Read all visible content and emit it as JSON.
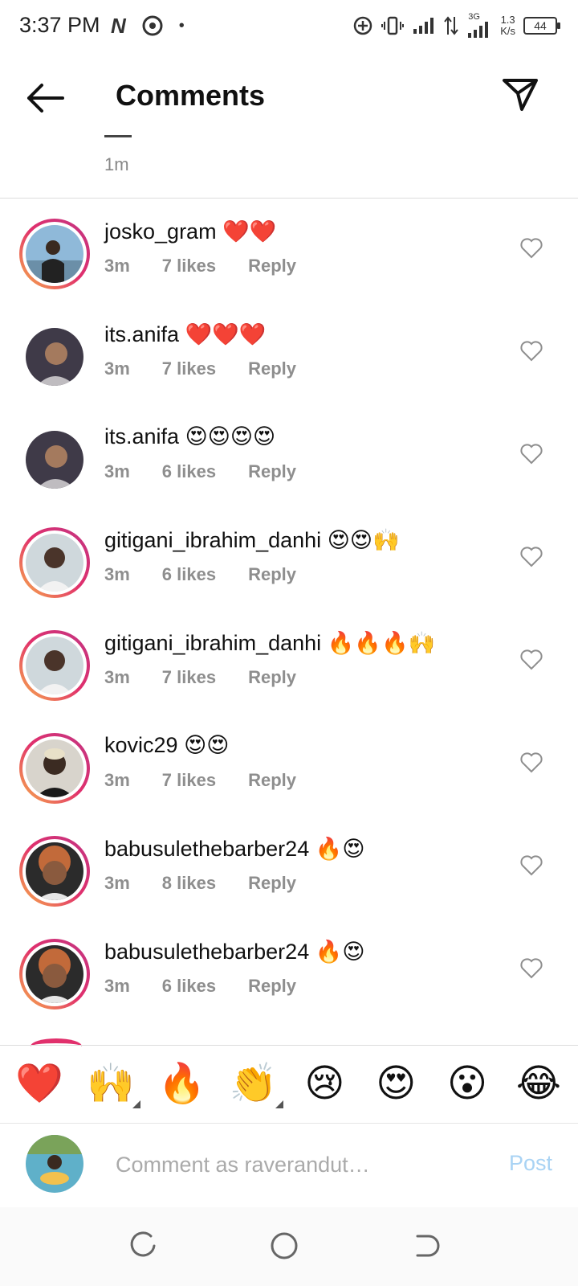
{
  "status_bar": {
    "time": "3:37 PM",
    "network_speed_value": "1.3",
    "network_speed_unit": "K/s",
    "network_type": "3G",
    "battery": "44"
  },
  "header": {
    "title": "Comments"
  },
  "caption": {
    "time": "1m"
  },
  "comments": [
    {
      "username": "josko_gram",
      "emojis": "❤️❤️",
      "time": "3m",
      "likes": "7 likes",
      "reply": "Reply",
      "ring": true
    },
    {
      "username": "its.anifa",
      "emojis": "❤️❤️❤️",
      "time": "3m",
      "likes": "7 likes",
      "reply": "Reply",
      "ring": false
    },
    {
      "username": "its.anifa",
      "emojis": "😍😍😍😍",
      "time": "3m",
      "likes": "6 likes",
      "reply": "Reply",
      "ring": false
    },
    {
      "username": "gitigani_ibrahim_danhi",
      "emojis": "😍😍🙌",
      "time": "3m",
      "likes": "6 likes",
      "reply": "Reply",
      "ring": true
    },
    {
      "username": "gitigani_ibrahim_danhi",
      "emojis": "🔥🔥🔥🙌",
      "time": "3m",
      "likes": "7 likes",
      "reply": "Reply",
      "ring": true
    },
    {
      "username": "kovic29",
      "emojis": "😍😍",
      "time": "3m",
      "likes": "7 likes",
      "reply": "Reply",
      "ring": true
    },
    {
      "username": "babusulethebarber24",
      "emojis": "🔥😍",
      "time": "3m",
      "likes": "8 likes",
      "reply": "Reply",
      "ring": true
    },
    {
      "username": "babusulethebarber24",
      "emojis": "🔥😍",
      "time": "3m",
      "likes": "6 likes",
      "reply": "Reply",
      "ring": true
    }
  ],
  "emoji_bar": [
    "❤️",
    "🙌",
    "🔥",
    "👏",
    "😢",
    "😍",
    "😮",
    "😂"
  ],
  "input": {
    "placeholder": "Comment as raverandut…",
    "post_label": "Post"
  },
  "colors": {
    "story_ring": "#e1306c",
    "post_disabled": "#a9d3f4",
    "meta_gray": "#8e8e8e"
  }
}
